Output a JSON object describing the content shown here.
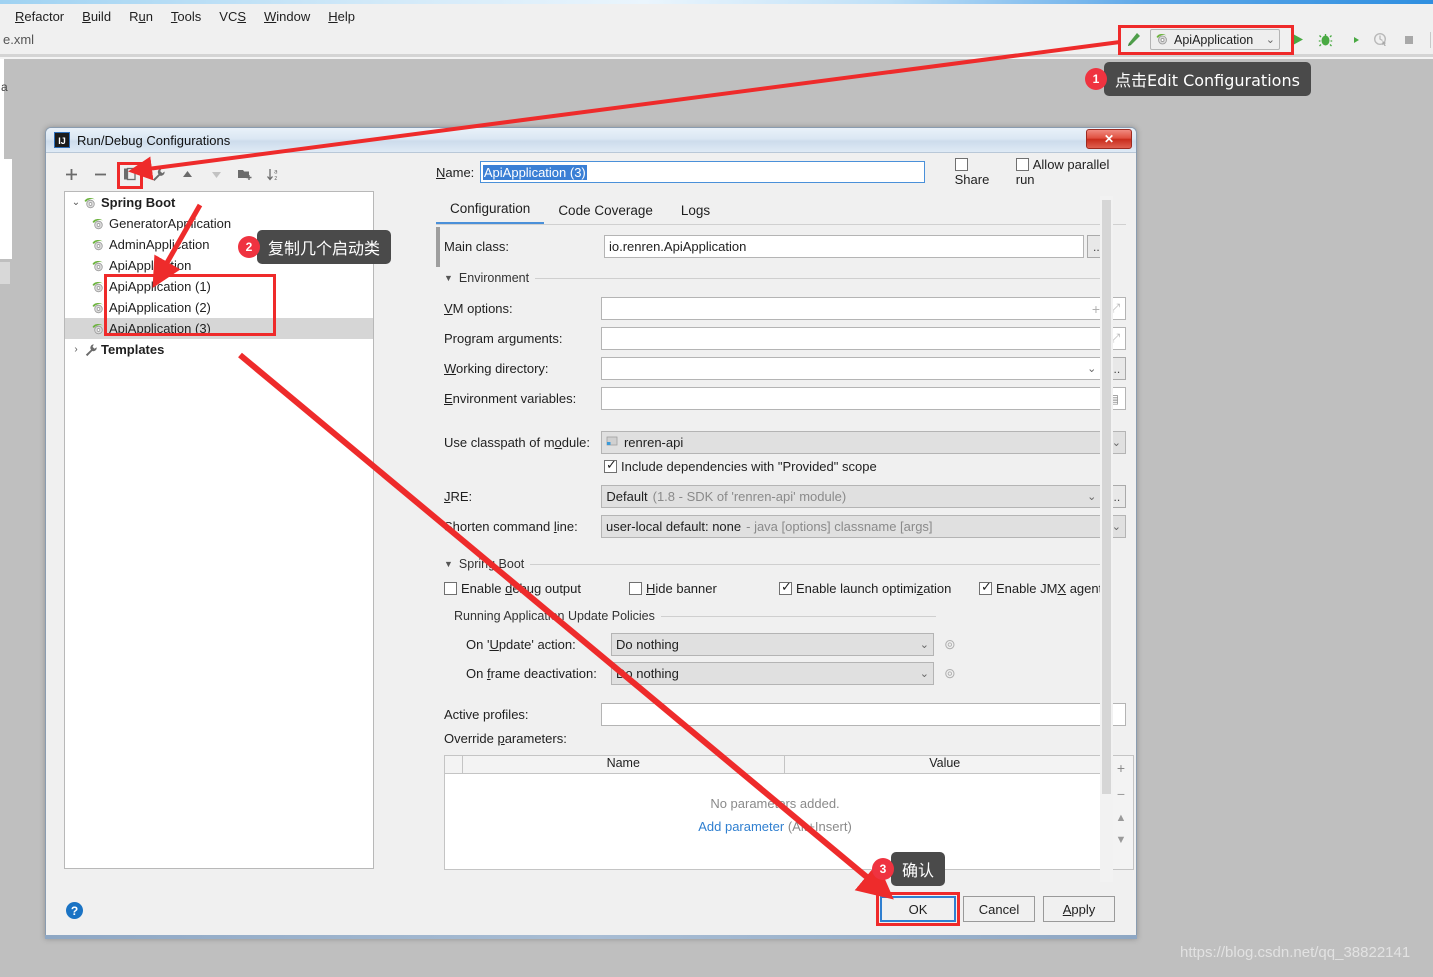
{
  "menubar": {
    "items": [
      {
        "label": "Refactor",
        "mnemonic": "R"
      },
      {
        "label": "Build",
        "mnemonic": "B"
      },
      {
        "label": "Run",
        "mnemonic": "u"
      },
      {
        "label": "Tools",
        "mnemonic": "T"
      },
      {
        "label": "VCS",
        "mnemonic": "S"
      },
      {
        "label": "Window",
        "mnemonic": "W"
      },
      {
        "label": "Help",
        "mnemonic": "H"
      }
    ]
  },
  "editor": {
    "tab_label": "e.xml",
    "side_letter": "a"
  },
  "toolbar": {
    "make_icon": "hammer-icon",
    "run_config_name": "ApiApplication",
    "chevron": "⌄",
    "buttons": [
      {
        "name": "run-button",
        "glyph": "▶"
      },
      {
        "name": "debug-button",
        "glyph": "🐞"
      },
      {
        "name": "run-with-coverage-button",
        "glyph": "C▶"
      },
      {
        "name": "profile-button",
        "glyph": "⏱"
      },
      {
        "name": "stop-button",
        "glyph": "■"
      }
    ]
  },
  "callouts": [
    {
      "num": "1",
      "text": "点击Edit Configurations"
    },
    {
      "num": "2",
      "text": "复制几个启动类"
    },
    {
      "num": "3",
      "text": "确认"
    }
  ],
  "dialog": {
    "title": "Run/Debug Configurations",
    "close_label": "✕",
    "tree_toolbar": [
      {
        "name": "add-configuration-button",
        "glyph": "+"
      },
      {
        "name": "remove-configuration-button",
        "glyph": "−"
      },
      {
        "name": "copy-configuration-button",
        "glyph": "copy-icon"
      },
      {
        "name": "edit-templates-button",
        "glyph": "wrench-icon"
      },
      {
        "name": "move-up-button",
        "glyph": "▲"
      },
      {
        "name": "move-down-button",
        "glyph": "▼"
      },
      {
        "name": "move-into-folder-button",
        "glyph": "folder-add-icon"
      },
      {
        "name": "sort-configurations-button",
        "glyph": "sort-az-icon"
      }
    ],
    "tree": [
      {
        "label": "Spring Boot",
        "level": 0,
        "bold": true,
        "arrow": "⌄",
        "icon": "spring-boot-icon",
        "selected": false
      },
      {
        "label": "GeneratorApplication",
        "level": 1,
        "bold": false,
        "arrow": "",
        "icon": "spring-boot-icon",
        "selected": false
      },
      {
        "label": "AdminApplication",
        "level": 1,
        "bold": false,
        "arrow": "",
        "icon": "spring-boot-icon",
        "selected": false
      },
      {
        "label": "ApiApplication",
        "level": 1,
        "bold": false,
        "arrow": "",
        "icon": "spring-boot-icon",
        "selected": false
      },
      {
        "label": "ApiApplication (1)",
        "level": 1,
        "bold": false,
        "arrow": "",
        "icon": "spring-boot-icon",
        "selected": false
      },
      {
        "label": "ApiApplication (2)",
        "level": 1,
        "bold": false,
        "arrow": "",
        "icon": "spring-boot-icon",
        "selected": false
      },
      {
        "label": "ApiApplication (3)",
        "level": 1,
        "bold": false,
        "arrow": "",
        "icon": "spring-boot-icon",
        "selected": true
      },
      {
        "label": "Templates",
        "level": 0,
        "bold": true,
        "arrow": "›",
        "icon": "wrench-icon",
        "selected": false
      }
    ],
    "name_label": "Name:",
    "name_value": "ApiApplication (3)",
    "share_label": "Share",
    "share_checked": false,
    "allow_parallel_label": "Allow parallel run",
    "allow_parallel_checked": false,
    "tabs": [
      {
        "label": "Configuration",
        "active": true
      },
      {
        "label": "Code Coverage",
        "active": false
      },
      {
        "label": "Logs",
        "active": false
      }
    ],
    "fields": {
      "main_class_label": "Main class:",
      "main_class_value": "io.renren.ApiApplication",
      "environment_section": "Environment",
      "vm_options_label": "VM options:",
      "vm_options_value": "",
      "program_arguments_label": "Program arguments:",
      "program_arguments_value": "",
      "working_directory_label": "Working directory:",
      "working_directory_value": "",
      "environment_variables_label": "Environment variables:",
      "environment_variables_value": "",
      "classpath_label": "Use classpath of module:",
      "classpath_value": "renren-api",
      "include_deps_label": "Include dependencies with \"Provided\" scope",
      "include_deps_checked": true,
      "jre_label": "JRE:",
      "jre_value": "Default",
      "jre_hint": "(1.8 - SDK of 'renren-api' module)",
      "shorten_label": "Shorten command line:",
      "shorten_value": "user-local default: none",
      "shorten_hint": "- java [options] classname [args]",
      "spring_boot_section": "Spring Boot",
      "checkboxes": [
        {
          "label": "Enable debug output",
          "checked": false
        },
        {
          "label": "Hide banner",
          "checked": false
        },
        {
          "label": "Enable launch optimization",
          "checked": true
        },
        {
          "label": "Enable JMX agent",
          "checked": true
        }
      ],
      "update_policies_section": "Running Application Update Policies",
      "on_update_label": "On 'Update' action:",
      "on_update_value": "Do nothing",
      "on_frame_label": "On frame deactivation:",
      "on_frame_value": "Do nothing",
      "active_profiles_label": "Active profiles:",
      "active_profiles_value": "",
      "override_params_label": "Override parameters:",
      "override_col_name": "Name",
      "override_col_value": "Value",
      "override_empty_text": "No parameters added.",
      "override_add_link": "Add parameter",
      "override_add_shortcut": "(Alt+Insert)",
      "override_side_buttons": [
        "+",
        "−",
        "▲",
        "▼"
      ],
      "ellipsis_label": "..."
    },
    "footer": {
      "help_label": "?",
      "ok_label": "OK",
      "cancel_label": "Cancel",
      "apply_label": "Apply"
    }
  },
  "watermark": "https://blog.csdn.net/qq_38822141",
  "colors": {
    "accent_blue": "#4a90d9",
    "annotation_red": "#ef2a2a",
    "callout_bg": "#4a4a4a",
    "spring_green": "#5aa84f",
    "desktop_gray": "#bfbfbf"
  }
}
